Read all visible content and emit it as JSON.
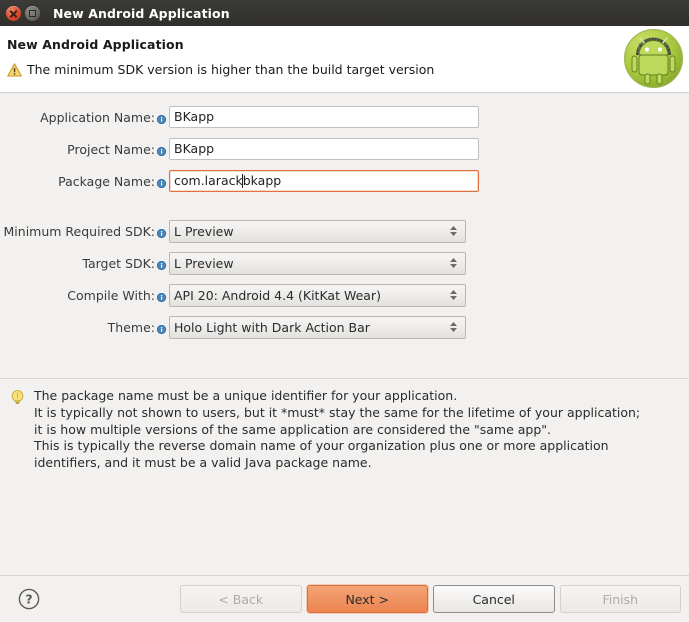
{
  "window": {
    "title": "New Android Application",
    "close_icon": "close-icon",
    "maximize_icon": "maximize-icon"
  },
  "header": {
    "title": "New Android Application",
    "warning_icon": "warning-triangle-icon",
    "warning_message": "The minimum SDK version is higher than the build target version",
    "logo_icon": "android-robot-logo"
  },
  "form": {
    "info_icon": "info-icon",
    "fields": [
      {
        "label": "Application Name:",
        "value": "BKapp",
        "type": "text",
        "state": "normal",
        "name": "application-name-input"
      },
      {
        "label": "Project Name:",
        "value": "BKapp",
        "type": "text",
        "state": "normal",
        "name": "project-name-input"
      },
      {
        "label": "Package Name:",
        "value_before_caret": "com.larack",
        "value_after_caret": "bkapp",
        "value": "com.larackbkapp",
        "type": "text",
        "state": "error",
        "name": "package-name-input"
      }
    ],
    "combos": [
      {
        "label": "Minimum Required SDK:",
        "value": "L Preview",
        "name": "minimum-required-sdk-combo"
      },
      {
        "label": "Target SDK:",
        "value": "L Preview",
        "name": "target-sdk-combo"
      },
      {
        "label": "Compile With:",
        "value": "API 20: Android 4.4 (KitKat Wear)",
        "name": "compile-with-combo"
      },
      {
        "label": "Theme:",
        "value": "Holo Light with Dark Action Bar",
        "name": "theme-combo"
      }
    ]
  },
  "info_panel": {
    "bulb_icon": "lightbulb-icon",
    "lines": [
      "The package name must be a unique identifier for your application.",
      "It is typically not shown to users, but it *must* stay the same for the lifetime of your application;",
      "it is how multiple versions of the same application are considered the \"same app\".",
      "This is typically the reverse domain name of your organization plus one or more application",
      "identifiers, and it must be a valid Java package name."
    ]
  },
  "footer": {
    "help_icon": "help-question-icon",
    "buttons": [
      {
        "label": "< Back",
        "state": "disabled",
        "name": "back-button"
      },
      {
        "label": "Next >",
        "state": "primary",
        "name": "next-button"
      },
      {
        "label": "Cancel",
        "state": "normal",
        "name": "cancel-button"
      },
      {
        "label": "Finish",
        "state": "disabled",
        "name": "finish-button"
      }
    ]
  },
  "colors": {
    "titlebar_bg": "#302f2b",
    "body_bg": "#f2f1f0",
    "accent_orange": "#ec8450",
    "error_border": "#e0703c",
    "info_blue": "#4a86b8",
    "warning_yellow": "#f0c420",
    "android_green": "#a4c639"
  }
}
